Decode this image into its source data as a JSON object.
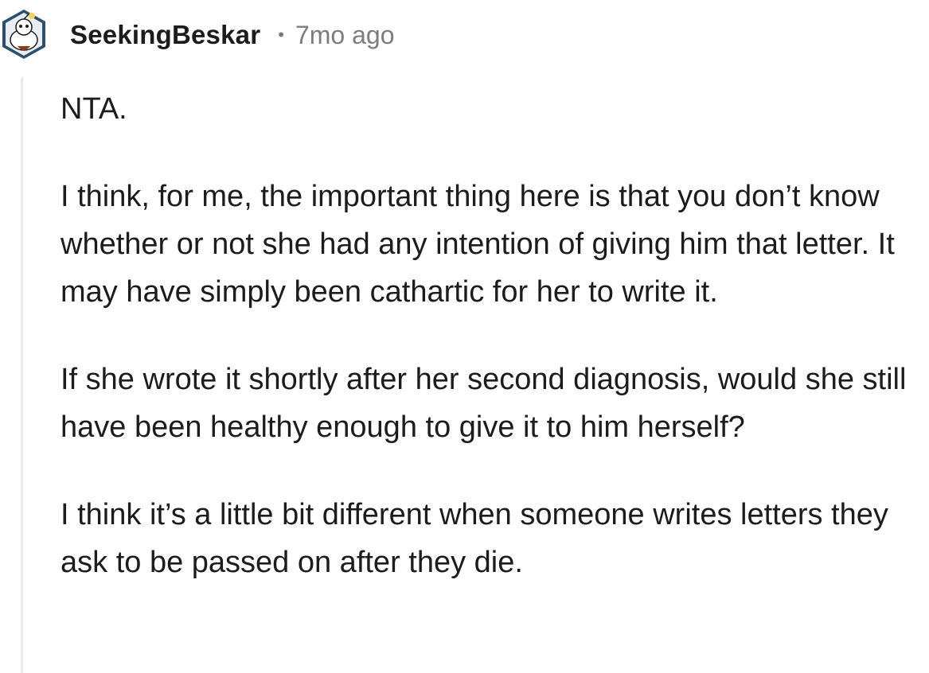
{
  "comment": {
    "author": "SeekingBeskar",
    "separator": "•",
    "timestamp": "7mo ago",
    "avatar_icon": "snoo-avatar-icon",
    "paragraphs": [
      "NTA.",
      "I think, for me, the important thing here is that you don’t know whether or not she had any intention of giving him that letter. It may have simply been cathartic for her to write it.",
      "If she wrote it shortly after her second diagnosis, would she still have been healthy enough to give it to him herself?",
      "I think it’s a little bit different when someone writes letters they ask to be passed on after they die."
    ]
  }
}
